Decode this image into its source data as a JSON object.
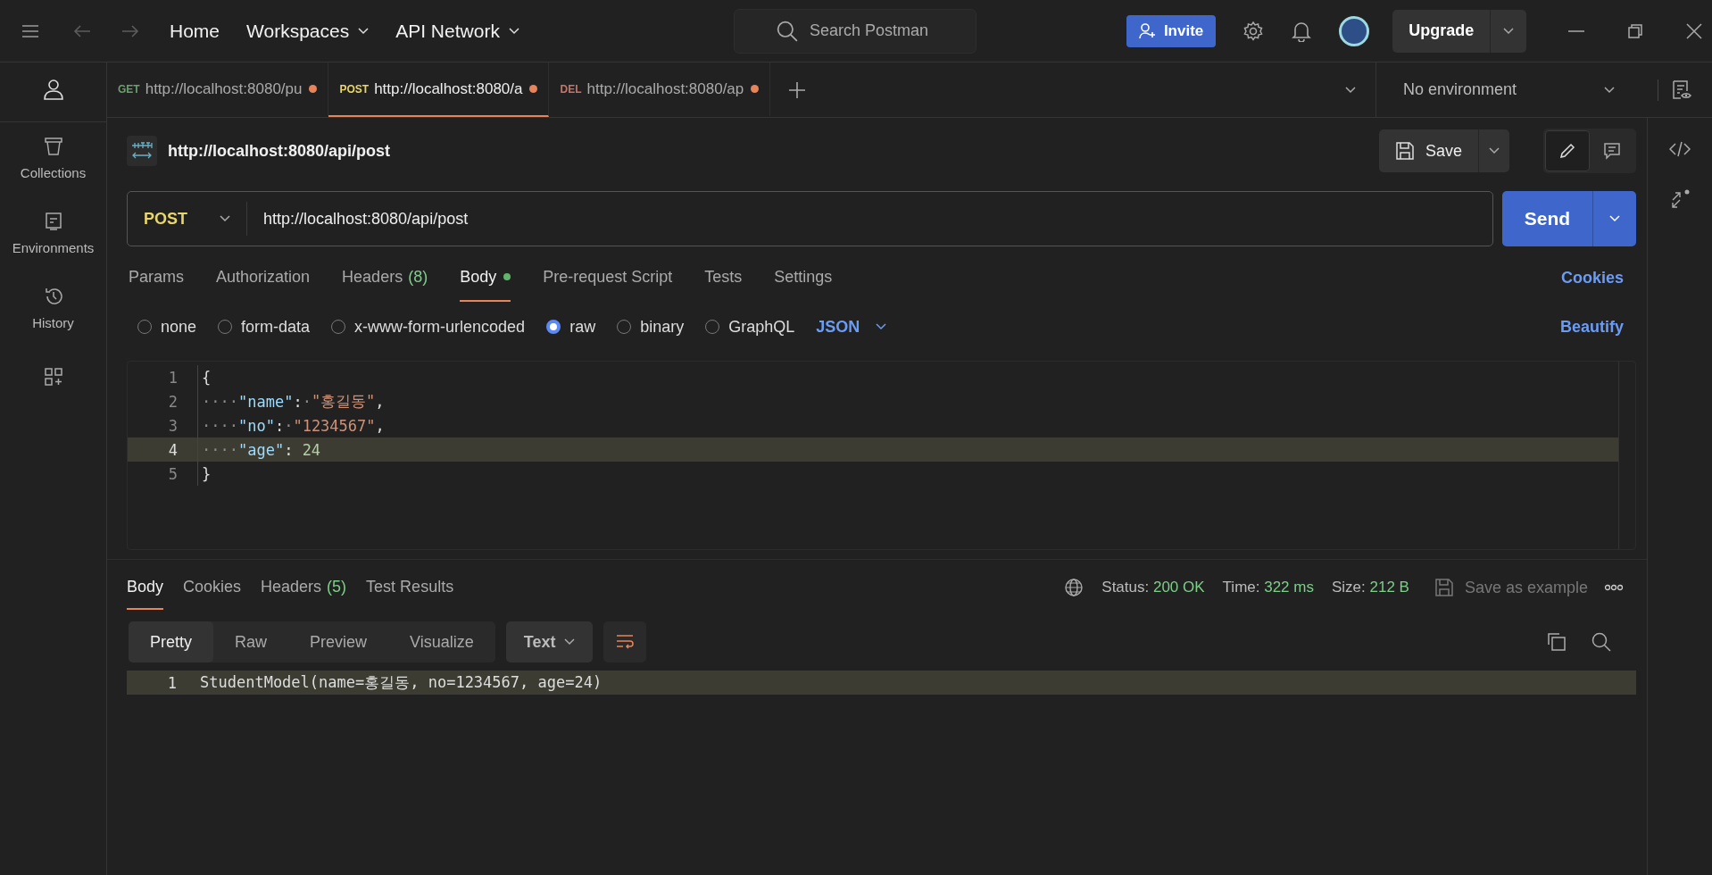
{
  "topbar": {
    "nav": [
      {
        "label": "Home",
        "dropdown": false
      },
      {
        "label": "Workspaces",
        "dropdown": true
      },
      {
        "label": "API Network",
        "dropdown": true
      }
    ],
    "search_placeholder": "Search Postman",
    "invite": "Invite",
    "upgrade": "Upgrade"
  },
  "sidebar": {
    "items": [
      {
        "label": "Collections"
      },
      {
        "label": "Environments"
      },
      {
        "label": "History"
      }
    ]
  },
  "tabs": [
    {
      "method": "GET",
      "color": "#6a9f6e",
      "url": "http://localhost:8080/pu",
      "selected": false,
      "unsaved": true
    },
    {
      "method": "POST",
      "color": "#e8d56b",
      "url": "http://localhost:8080/a",
      "selected": true,
      "unsaved": true
    },
    {
      "method": "DEL",
      "color": "#c7756a",
      "url": "http://localhost:8080/ap",
      "selected": false,
      "unsaved": true
    }
  ],
  "environment": "No environment",
  "request": {
    "name": "http://localhost:8080/api/post",
    "method": "POST",
    "url": "http://localhost:8080/api/post",
    "save": "Save",
    "send": "Send"
  },
  "request_tabs": [
    {
      "label": "Params",
      "selected": false,
      "dot": false
    },
    {
      "label": "Authorization",
      "selected": false,
      "dot": false
    },
    {
      "label": "Headers",
      "count": "(8)",
      "selected": false,
      "dot": false
    },
    {
      "label": "Body",
      "selected": true,
      "dot": true
    },
    {
      "label": "Pre-request Script",
      "selected": false,
      "dot": false
    },
    {
      "label": "Tests",
      "selected": false,
      "dot": false
    },
    {
      "label": "Settings",
      "selected": false,
      "dot": false
    }
  ],
  "cookies_link": "Cookies",
  "body_types": [
    {
      "label": "none",
      "selected": false
    },
    {
      "label": "form-data",
      "selected": false
    },
    {
      "label": "x-www-form-urlencoded",
      "selected": false
    },
    {
      "label": "raw",
      "selected": true
    },
    {
      "label": "binary",
      "selected": false
    },
    {
      "label": "GraphQL",
      "selected": false
    }
  ],
  "language": "JSON",
  "beautify": "Beautify",
  "editor": {
    "lines": [
      {
        "number": "1",
        "active": false,
        "tokens": [
          {
            "kind": "punct",
            "text": "{"
          }
        ]
      },
      {
        "number": "2",
        "active": false,
        "tokens": [
          {
            "kind": "space",
            "text": "····"
          },
          {
            "kind": "key",
            "text": "\"name\""
          },
          {
            "kind": "punct",
            "text": ":"
          },
          {
            "kind": "space",
            "text": "·"
          },
          {
            "kind": "string",
            "text": "\"홍길동\""
          },
          {
            "kind": "punct",
            "text": ","
          }
        ]
      },
      {
        "number": "3",
        "active": false,
        "tokens": [
          {
            "kind": "space",
            "text": "····"
          },
          {
            "kind": "key",
            "text": "\"no\""
          },
          {
            "kind": "punct",
            "text": ":"
          },
          {
            "kind": "space",
            "text": "·"
          },
          {
            "kind": "string",
            "text": "\"1234567\""
          },
          {
            "kind": "punct",
            "text": ","
          }
        ]
      },
      {
        "number": "4",
        "active": true,
        "tokens": [
          {
            "kind": "space",
            "text": "····"
          },
          {
            "kind": "key",
            "text": "\"age\""
          },
          {
            "kind": "punct",
            "text": ": "
          },
          {
            "kind": "number",
            "text": "24"
          }
        ]
      },
      {
        "number": "5",
        "active": false,
        "tokens": [
          {
            "kind": "punct",
            "text": "}"
          }
        ]
      }
    ]
  },
  "response": {
    "tabs": [
      {
        "label": "Body",
        "selected": true
      },
      {
        "label": "Cookies",
        "selected": false
      },
      {
        "label": "Headers",
        "count": "(5)",
        "selected": false
      },
      {
        "label": "Test Results",
        "selected": false
      }
    ],
    "stats": [
      {
        "label": "Status:",
        "value": "200 OK"
      },
      {
        "label": "Time:",
        "value": "322 ms"
      },
      {
        "label": "Size:",
        "value": "212 B"
      }
    ],
    "save_example": {
      "label": "Save as example",
      "disabled": true
    },
    "view_modes": [
      {
        "label": "Pretty",
        "selected": true
      },
      {
        "label": "Raw",
        "selected": false
      },
      {
        "label": "Preview",
        "selected": false
      },
      {
        "label": "Visualize",
        "selected": false
      }
    ],
    "format": "Text",
    "wrap_on": true,
    "lines": [
      {
        "number": "1",
        "active": true,
        "text": "StudentModel(name=홍길동, no=1234567, age=24)"
      }
    ]
  }
}
